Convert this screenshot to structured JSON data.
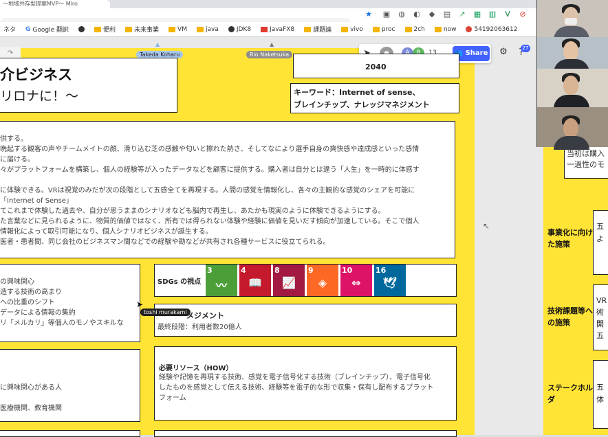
{
  "browser": {
    "tab_title": "〜地域共存型提案MVP〜 Miro",
    "bookmarks": [
      "ネタ",
      "Google 翻訳",
      "",
      "便利",
      "未来事業",
      "VM",
      "java",
      "JDK8",
      "JavaFX8",
      "課題論",
      "vivo",
      "proc",
      "2ch",
      "now",
      "54192063612"
    ]
  },
  "board_toolbar": {
    "collaborator_count": "13",
    "share_label": "Share",
    "notification_count": "27",
    "avatar_letters": [
      "A",
      "B"
    ]
  },
  "cursors": {
    "takeda": "Takeda Koharu",
    "rio": "Rio Naketsuka",
    "toshi": "toshi murakami"
  },
  "title_card": {
    "line1": "介ビジネス",
    "line2": "リロナに！〜"
  },
  "year_card": {
    "year": "2040"
  },
  "keyword_card": {
    "line1": "キーワード：Internet of sense、",
    "line2": "ブレインチップ、ナレッジマネジメント"
  },
  "description": {
    "lines": [
      "供する。",
      "晩起する観客の声やチームメイトの顔、滑り込む芝の感触や匂いと擦れた熱さ、そしてなにより選手自身の爽快感や達成感といった感情",
      "に届ける。",
      "々がプラットフォームを構築し、個人の経験等が入ったデータなどを顧客に提供する。購入者は自分とは違う「人生」を一時的に体感す",
      "",
      "に体験できる。VRは視覚のみだが次の段階として五感全てを再現する。人間の感覚を情報化し、各々の主観的な感覚のシェアを可能に",
      "「Internet of Sense」",
      "てこれまで体験した過去や、自分が思うままのシナリオなども脳内で再生し、あたかも現実のように体験できるようにする。",
      "た言葉などに見られるように、物質的価値ではなく、所有では得られない体験や経験に価値を見いだす傾向が加速している。そこで個人",
      "情報化によって取引可能になり、個人シナリオビジネスが誕生する。",
      "医者・患者間、同じ会社のビジネスマン間などでの経験や勘などが共有され各種サービスに役立てられる。"
    ]
  },
  "trends_card": {
    "lines": [
      "の興味関心",
      "造する技術の高まり",
      "への比重のシフト",
      "データによる情報の集約",
      "リ「メルカリ」等個人のモノやスキルな"
    ]
  },
  "sdgs_card": {
    "label": "SDGs の視点",
    "goals": [
      {
        "num": "3",
        "color": "#4c9f38",
        "glyph": "〰"
      },
      {
        "num": "4",
        "color": "#c5192d",
        "glyph": "📖"
      },
      {
        "num": "8",
        "color": "#a21942",
        "glyph": "📈"
      },
      {
        "num": "9",
        "color": "#fd6925",
        "glyph": "◈"
      },
      {
        "num": "10",
        "color": "#dd1367",
        "glyph": "⇔"
      },
      {
        "num": "16",
        "color": "#00689d",
        "glyph": "🕊"
      }
    ]
  },
  "km_card": {
    "title": "メジメント",
    "subtitle": "最終段階：利用者数20億人"
  },
  "customers_card": {
    "lines": [
      "に興味関心がある人",
      "",
      "医療機関、教育機関"
    ]
  },
  "resources_card": {
    "title": "必要リソース（HOW）",
    "lines": [
      "経験や記憶を再現する技術、感覚を電子信号化する技術（ブレインチップ）、電子信号化",
      "したものを感覚として伝える技術、経験等を電子的な形で収集・保有し配布するプラット",
      "フォーム"
    ]
  },
  "right_panel": {
    "top_note_lines": [
      "当初は購入",
      "一過性のモ"
    ],
    "rows": [
      {
        "label": "事業化に向けた施策",
        "snippet": "五\nよ"
      },
      {
        "label": "技術課題等への施策",
        "snippet": "VR\n術\n開\n五"
      },
      {
        "label": "ステークホルダ",
        "snippet": "五\n体"
      }
    ]
  }
}
